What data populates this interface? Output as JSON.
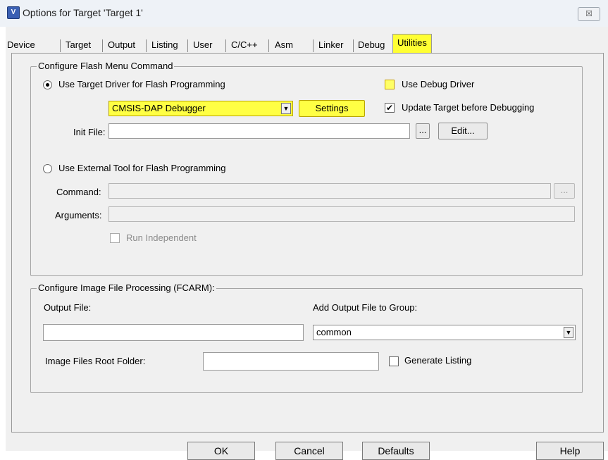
{
  "window": {
    "title": "Options for Target 'Target 1'",
    "close_label": "☒"
  },
  "tabs": [
    "Device",
    "Target",
    "Output",
    "Listing",
    "User",
    "C/C++",
    "Asm",
    "Linker",
    "Debug",
    "Utilities"
  ],
  "active_tab": "Utilities",
  "flash_group": {
    "legend": "Configure Flash Menu Command",
    "use_target_driver_label": "Use Target Driver for Flash Programming",
    "use_target_driver_selected": true,
    "driver_select_value": "CMSIS-DAP Debugger",
    "settings_button": "Settings",
    "use_debug_driver_label": "Use Debug Driver",
    "use_debug_driver_checked": false,
    "update_target_label": "Update Target before Debugging",
    "update_target_checked": true,
    "init_file_label": "Init File:",
    "init_file_value": "",
    "browse_button": "...",
    "edit_button": "Edit...",
    "use_external_tool_label": "Use External Tool for Flash Programming",
    "use_external_tool_selected": false,
    "command_label": "Command:",
    "command_value": "",
    "command_browse_button": "...",
    "arguments_label": "Arguments:",
    "arguments_value": "",
    "run_independent_label": "Run Independent"
  },
  "image_group": {
    "legend": "Configure Image File Processing (FCARM):",
    "output_file_label": "Output File:",
    "output_file_value": "",
    "add_output_label": "Add Output File  to Group:",
    "group_select_value": "common",
    "root_folder_label": "Image Files Root Folder:",
    "root_folder_value": "",
    "generate_listing_label": "Generate Listing",
    "generate_listing_checked": false
  },
  "buttons": {
    "ok": "OK",
    "cancel": "Cancel",
    "defaults": "Defaults",
    "help": "Help"
  },
  "colors": {
    "highlight": "#ffff33",
    "dialog_bg": "#f0f0f0"
  }
}
